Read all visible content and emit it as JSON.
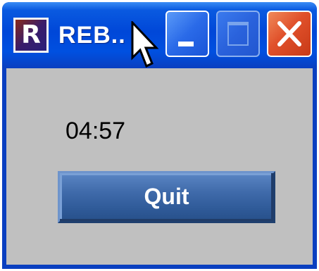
{
  "window": {
    "title": "REB..",
    "icon_letter": "R",
    "icon": "rebol-r-icon"
  },
  "titlebar_buttons": {
    "minimize_icon": "minimize-icon",
    "maximize_icon": "maximize-icon",
    "close_icon": "close-icon"
  },
  "content": {
    "time": "04:57",
    "quit_label": "Quit"
  },
  "cursor": {
    "icon": "arrow-cursor-icon"
  },
  "colors": {
    "titlebar": "#0050e0",
    "client_bg": "#c0c0c0",
    "quit_button": "#3f6aaa",
    "close_button": "#e0502a"
  }
}
